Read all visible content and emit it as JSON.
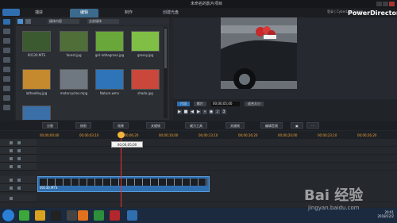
{
  "window": {
    "title": "未命名的影片项目"
  },
  "modes": {
    "capture": "捕获",
    "edit": "编辑",
    "produce": "制作",
    "create_disc": "创建光盘"
  },
  "brand": "PowerDirector",
  "user": "登录 | CyberLink Signin",
  "library": {
    "filter_dropdown": "媒体内容",
    "sort_dropdown": "全部媒体",
    "items": [
      {
        "name": "00130.MTS",
        "color": "#3b5a2f"
      },
      {
        "name": "forest.jpg",
        "color": "#4f6e38"
      },
      {
        "name": "girl-inthegrass.jpg",
        "color": "#6aa73a"
      },
      {
        "name": "grassy.jpg",
        "color": "#7fbf45"
      },
      {
        "name": "lotheelley.jpg",
        "color": "#c58a2e"
      },
      {
        "name": "motorcycles.mpg",
        "color": "#6f7880"
      },
      {
        "name": "Nature.wmv",
        "color": "#2f74b8"
      },
      {
        "name": "shade.jpg",
        "color": "#c9473b"
      }
    ]
  },
  "preview": {
    "mode_clip": "片段",
    "mode_movie": "影片",
    "timecode": "00;00;05;00",
    "zoom": "适合大小"
  },
  "function_bar": {
    "split": "分割",
    "trim": "修剪",
    "effects": "效果",
    "keyframe": "关键帧",
    "power_tools": "威力工具",
    "keyframes_alt": "关键帧",
    "edit_audio": "编辑音频"
  },
  "timeline": {
    "ruler_ticks": [
      "00;00;00;00",
      "00;00;03;10",
      "00;00;06;20",
      "00;00;10;00",
      "00;00;13;10",
      "00;00;16;20",
      "00;00;20;00",
      "00;00;23;10",
      "00;00;26;20"
    ],
    "tooltip": "00;00;05;00",
    "clip_name": "00130.MTS",
    "track_count": 8
  },
  "taskbar": {
    "time": "20:01",
    "date": "2018/12/2"
  },
  "watermark": {
    "main": "Bai 经验",
    "sub": "jingyan.baidu.com"
  }
}
